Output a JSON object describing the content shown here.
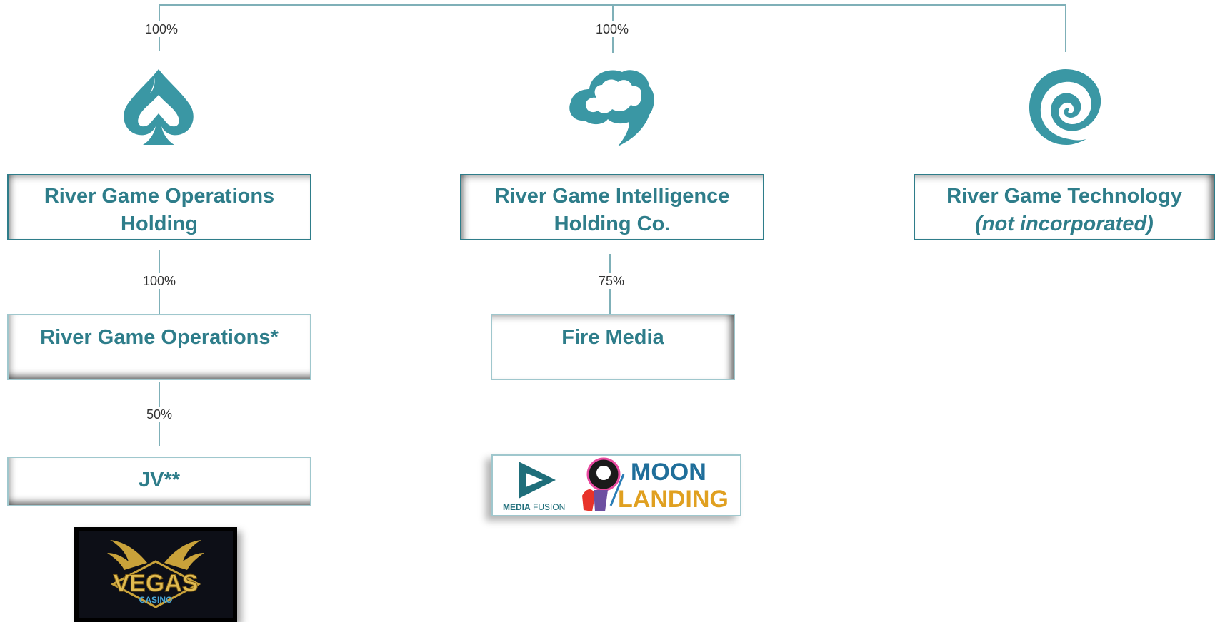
{
  "ownership": {
    "top_left": "100%",
    "top_middle": "100%",
    "operations": "100%",
    "fire_media": "75%",
    "jv": "50%"
  },
  "entities": {
    "operations_holding": {
      "line1": "River Game Operations",
      "line2": "Holding"
    },
    "intelligence_holding": {
      "line1": "River Game Intelligence",
      "line2": "Holding Co."
    },
    "technology": {
      "line1": "River Game Technology",
      "line2": "(not incorporated)"
    },
    "operations": {
      "line1": "River Game Operations*"
    },
    "fire_media": {
      "line1": "Fire Media"
    },
    "jv": {
      "line1": "JV**"
    }
  },
  "logos": {
    "vegas": {
      "main": "VEGAS",
      "sub": "CASINO"
    },
    "mediafusion": {
      "bold": "MEDIA",
      "rest": "FUSION"
    },
    "moonlanding": {
      "top": "MOON",
      "bottom": "LANDING"
    }
  },
  "icons": [
    "spade-icon",
    "cloud-icon",
    "spiral-icon"
  ],
  "colors": {
    "teal": "#2e7d8a",
    "icon_teal": "#3a97a4",
    "connector": "#7fb0b8"
  }
}
